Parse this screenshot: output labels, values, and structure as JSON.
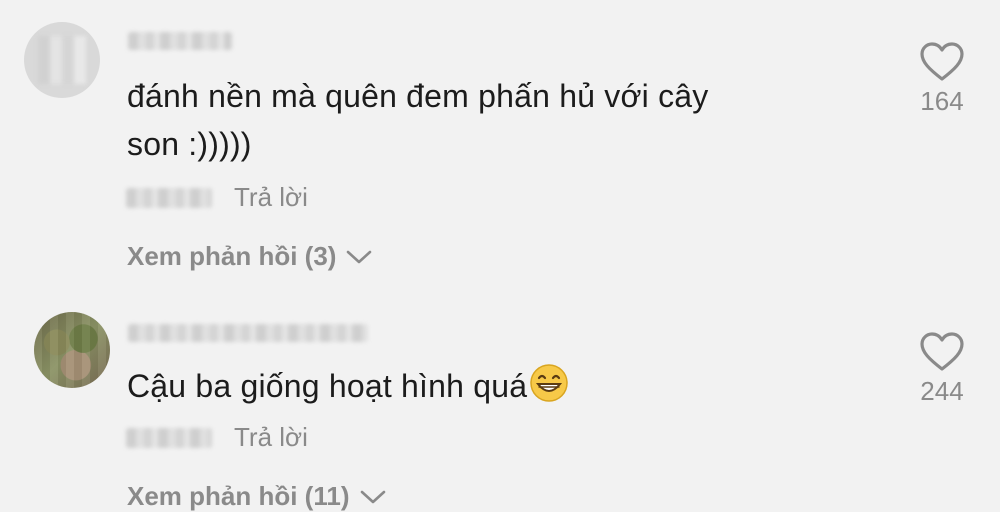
{
  "comments": [
    {
      "text_line1": "đánh nền mà quên đem phấn hủ với cây",
      "text_line2": "son :)))))",
      "reply_label": "Trả lời",
      "view_replies_label": "Xem phản hồi (3)",
      "like_count": "164"
    },
    {
      "text": "Cậu ba giống hoạt hình quá",
      "reply_label": "Trả lời",
      "view_replies_label": "Xem phản hồi (11)",
      "like_count": "244"
    }
  ],
  "icons": {
    "like": "heart-outline-icon",
    "expand": "chevron-down-icon",
    "emoji": "grinning-face-emoji"
  },
  "colors": {
    "background": "#f2f2f2",
    "text": "#1c1c1c",
    "muted": "#8a8a8a"
  }
}
